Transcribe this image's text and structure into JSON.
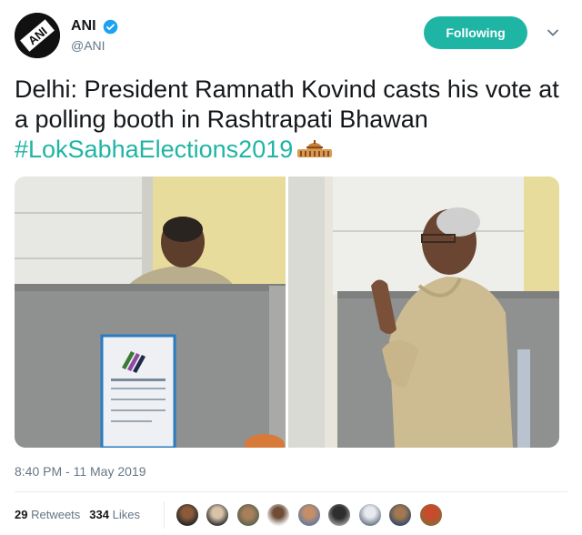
{
  "author": {
    "name": "ANI",
    "handle": "@ANI",
    "avatar_icon": "ani-logo-icon",
    "verified_icon": "verified-badge-icon"
  },
  "follow_button": {
    "label": "Following",
    "color": "#1fb5a4"
  },
  "caret_icon": "chevron-down-icon",
  "tweet": {
    "text": "Delhi: President Ramnath Kovind casts his vote at a polling booth in Rashtrapati Bhawan ",
    "hashtag": "#LokSabhaElections2019",
    "emoji": "parliament-building-icon"
  },
  "media": {
    "left_photo": "voting-booth-photo",
    "right_photo": "namaste-greeting-photo",
    "evm_logo_icon": "election-commission-logo-icon"
  },
  "timestamp": "8:40 PM - 11 May 2019",
  "stats": {
    "retweets_count": "29",
    "retweets_label": "Retweets",
    "likes_count": "334",
    "likes_label": "Likes"
  },
  "liked_by": [
    "user-avatar-1",
    "user-avatar-2",
    "user-avatar-3",
    "user-avatar-4",
    "user-avatar-5",
    "user-avatar-6",
    "user-avatar-7",
    "user-avatar-8",
    "user-avatar-9"
  ],
  "colors": {
    "accent": "#1fb5a4",
    "text": "#14171a",
    "muted": "#657786",
    "verified": "#1da1f2"
  }
}
